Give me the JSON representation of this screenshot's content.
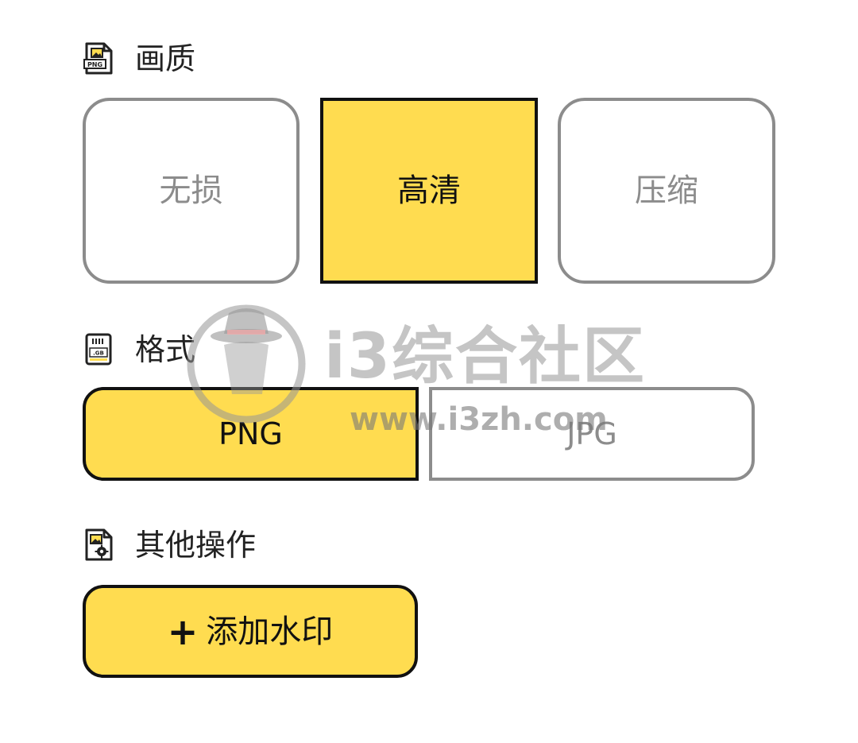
{
  "quality": {
    "title": "画质",
    "icon": "png-file-icon",
    "options": [
      "无损",
      "高清",
      "压缩"
    ],
    "selected": "高清"
  },
  "format": {
    "title": "格式",
    "icon": "sd-card-icon",
    "options": [
      "PNG",
      "JPG"
    ],
    "selected": "PNG"
  },
  "other_actions": {
    "title": "其他操作",
    "icon": "image-settings-icon",
    "add_watermark_label": "添加水印",
    "add_icon": "plus-icon"
  },
  "watermark_overlay": {
    "name": "i3综合社区",
    "url": "www.i3zh.com"
  },
  "colors": {
    "accent": "#ffdc50",
    "selected_border": "#111111",
    "unselected_border": "#8c8c8c",
    "unselected_text": "#8c8c8c"
  }
}
